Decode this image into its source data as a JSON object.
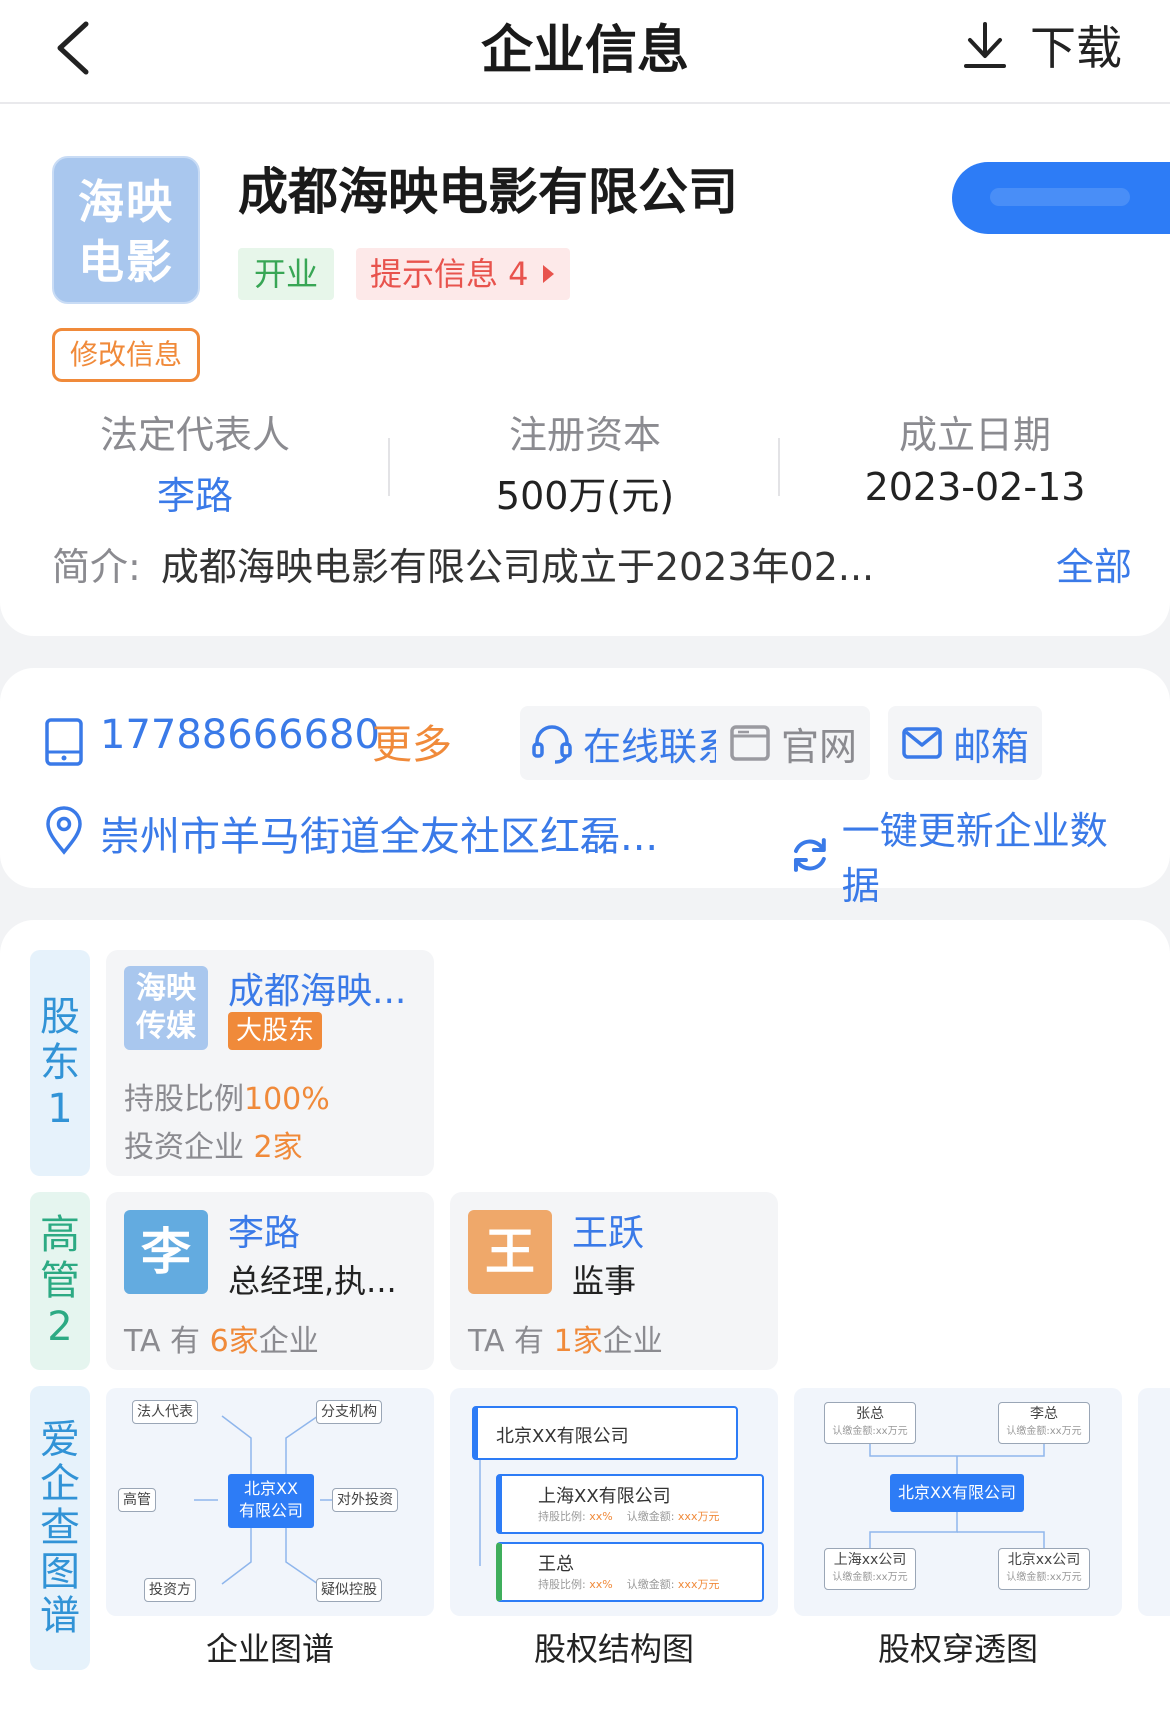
{
  "header": {
    "title": "企业信息",
    "download_label": "下载"
  },
  "company": {
    "logo_line1": "海映",
    "logo_line2": "电影",
    "name": "成都海映电影有限公司",
    "status_tag": "开业",
    "tip_tag": "提示信息 4",
    "modify_label": "修改信息"
  },
  "stats": [
    {
      "label": "法定代表人",
      "value": "李路"
    },
    {
      "label": "注册资本",
      "value": "500万(元)"
    },
    {
      "label": "成立日期",
      "value": "2023-02-13"
    }
  ],
  "intro": {
    "label": "简介:",
    "text": "成都海映电影有限公司成立于2023年02...",
    "all_label": "全部"
  },
  "contact": {
    "phone": "17788666680",
    "more_label": "更多",
    "online_label": "在线联系",
    "website_label": "官网",
    "email_label": "邮箱",
    "address": "崇州市羊马街道全友社区红磊...",
    "update_label": "一键更新企业数据"
  },
  "shareholders": {
    "tab": [
      "股",
      "东",
      "1"
    ],
    "items": [
      {
        "logo_line1": "海映",
        "logo_line2": "传媒",
        "name": "成都海映...",
        "badge": "大股东",
        "ratio_label": "持股比例",
        "ratio_value": "100%",
        "invest_label": "投资企业",
        "invest_value": "2",
        "invest_unit": "家"
      }
    ]
  },
  "executives": {
    "tab": [
      "高",
      "管",
      "2"
    ],
    "items": [
      {
        "avatar": "李",
        "name": "李路",
        "role": "总经理,执...",
        "prefix": "TA 有",
        "count": "6",
        "unit": "家",
        "suffix": "企业"
      },
      {
        "avatar": "王",
        "name": "王跃",
        "role": "监事",
        "prefix": "TA 有",
        "count": "1",
        "unit": "家",
        "suffix": "企业"
      }
    ]
  },
  "graphs": {
    "tab": [
      "爱",
      "企",
      "查",
      "图",
      "谱"
    ],
    "items": [
      {
        "label": "企业图谱",
        "center": "北京XX有限公司",
        "center_line1": "北京XX",
        "center_line2": "有限公司",
        "nodes": [
          "法人代表",
          "分支机构",
          "高管",
          "对外投资",
          "投资方",
          "疑似控股"
        ]
      },
      {
        "label": "股权结构图",
        "root": "北京XX有限公司",
        "child1": "上海XX有限公司",
        "child2": "王总",
        "ratio_label": "持股比例:",
        "ratio_value": "xx%",
        "amount_label": "认缴金额:",
        "amount_value": "xxx万元"
      },
      {
        "label": "股权穿透图",
        "top_left": "张总",
        "top_right": "李总",
        "center": "北京XX有限公司",
        "bottom_left": "上海xx公司",
        "bottom_right": "北京xx公司",
        "amount_note": "认缴金额:xx万元"
      }
    ]
  },
  "colors": {
    "accent": "#3a7ae8",
    "orange": "#f08a3a",
    "green": "#38a655",
    "red": "#e8534d"
  }
}
